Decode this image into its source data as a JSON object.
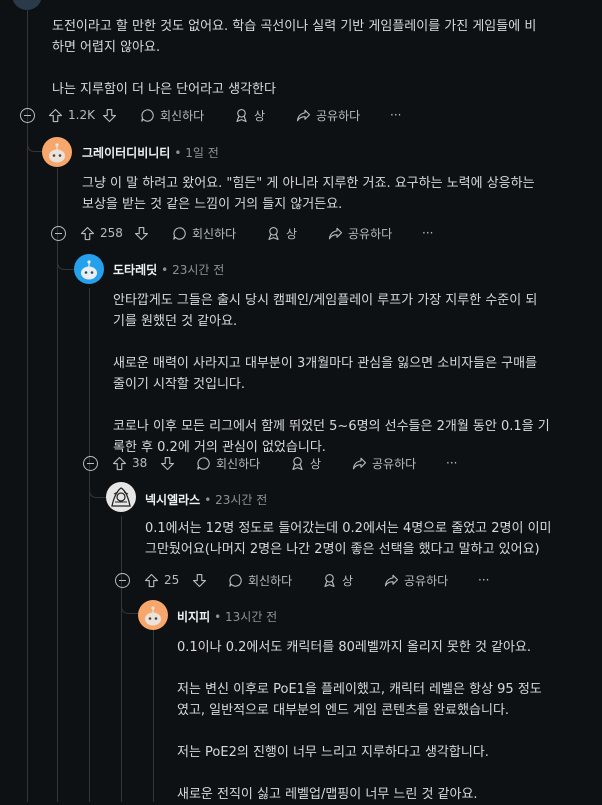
{
  "top_comment": {
    "text": "도전이라고 할 만한 것도 없어요. 학습 곡선이나 실력 기반 게임플레이를 가진 게임들에 비\n하면 어렵지 않아요.\n\n나는 지루함이 더 나은 단어라고 생각한다",
    "votes": "1.2K"
  },
  "labels": {
    "reply": "회신하다",
    "award": "상",
    "share": "공유하다",
    "more": "···"
  },
  "comments": [
    {
      "user": "그레이터디비니티",
      "time": "• 1일 전",
      "text": "그냥 이 말 하려고 왔어요. \"힘든\" 게 아니라 지루한 거죠. 요구하는 노력에 상응하는\n보상을 받는 것 같은 느낌이 거의 들지 않거든요.",
      "votes": "258"
    },
    {
      "user": "도타레딧",
      "time": "• 23시간 전",
      "text": "안타깝게도 그들은 출시 당시 캠페인/게임플레이 루프가 가장 지루한 수준이 되\n기를 원했던 것 같아요.\n\n새로운 매력이 사라지고 대부분이 3개월마다 관심을 잃으면 소비자들은 구매를\n줄이기 시작할 것입니다.\n\n코로나 이후 모든 리그에서 함께 뛰었던 5~6명의 선수들은 2개월 동안 0.1을 기\n록한 후 0.2에 거의 관심이 없었습니다.",
      "votes": "38"
    },
    {
      "user": "넥시엘라스",
      "time": "• 23시간 전",
      "text": "0.1에서는 12명 정도로 들어갔는데 0.2에서는 4명으로 줄었고 2명이 이미\n그만뒀어요(나머지 2명은 나간 2명이 좋은 선택을 했다고 말하고 있어요)",
      "votes": "25"
    },
    {
      "user": "비지피",
      "time": "• 13시간 전",
      "text": "0.1이나 0.2에서도 캐릭터를 80레벨까지 올리지 못한 것 같아요.\n\n저는 변신 이후로 PoE1을 플레이했고, 캐릭터 레벨은 항상 95 정도\n였고, 일반적으로 대부분의 엔드 게임 콘텐츠를 완료했습니다.\n\n저는 PoE2의 진행이 너무 느리고 지루하다고 생각합니다.\n\n새로운 전직이 싫고 레벨업/맵핑이 너무 느린 것 같아요."
    }
  ]
}
